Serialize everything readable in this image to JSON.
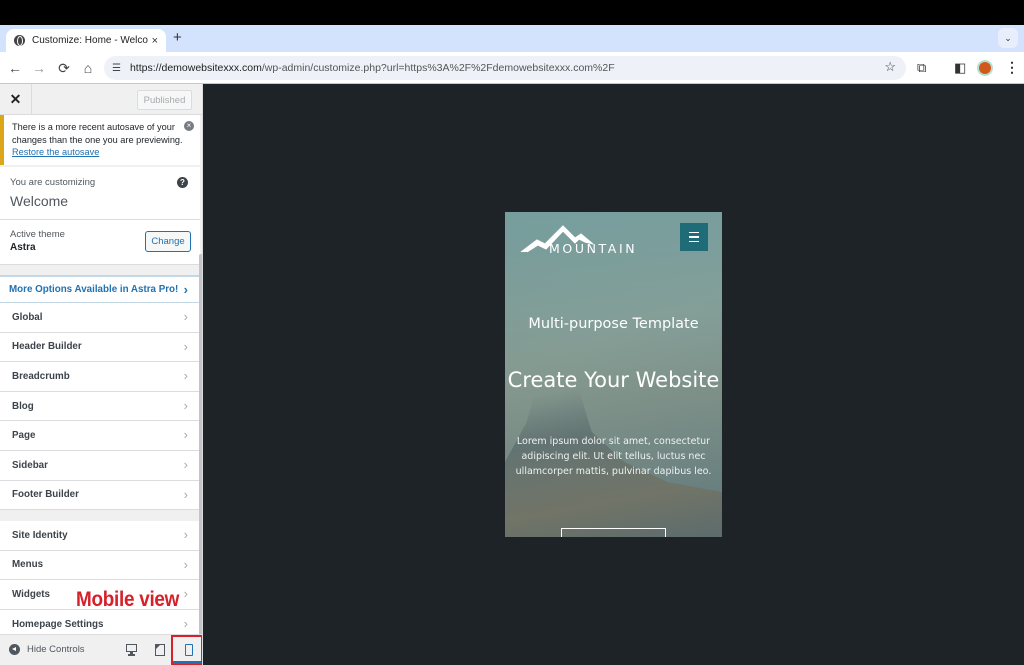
{
  "browser": {
    "tab_title": "Customize: Home - Welcome",
    "tab_close": "×",
    "new_tab": "+",
    "tab_list": "⌄",
    "url_host": "https://demowebsitexxx.com",
    "url_rest": "/wp-admin/customize.php?url=https%3A%2F%2Fdemowebsitexxx.com%2F",
    "nav": {
      "back": "←",
      "forward": "→",
      "reload": "⟳",
      "home": "⌂"
    },
    "bookmark_icon": "☆",
    "extensions_icon": "⧉",
    "sidepanel_icon": "◧",
    "menu_icon": "⋮"
  },
  "customizer": {
    "close_label": "✕",
    "publish_label": "Published",
    "notice": {
      "text": "There is a more recent autosave of your changes than the one you are previewing.",
      "link": "Restore the autosave",
      "dismiss": "×"
    },
    "customizing": {
      "label": "You are customizing",
      "title": "Welcome",
      "help": "?"
    },
    "theme": {
      "label": "Active theme",
      "name": "Astra",
      "change_label": "Change"
    },
    "pro_item": {
      "label": "More Options Available in Astra Pro!",
      "chev": "›"
    },
    "sections_group1": [
      {
        "label": "Global",
        "chev": "›"
      },
      {
        "label": "Header Builder",
        "chev": "›"
      },
      {
        "label": "Breadcrumb",
        "chev": "›"
      },
      {
        "label": "Blog",
        "chev": "›"
      },
      {
        "label": "Page",
        "chev": "›"
      },
      {
        "label": "Sidebar",
        "chev": "›"
      },
      {
        "label": "Footer Builder",
        "chev": "›"
      }
    ],
    "sections_group2": [
      {
        "label": "Site Identity",
        "chev": "›"
      },
      {
        "label": "Menus",
        "chev": "›"
      },
      {
        "label": "Widgets",
        "chev": "›"
      },
      {
        "label": "Homepage Settings",
        "chev": "›"
      }
    ],
    "footer": {
      "hide_controls": "Hide Controls",
      "active_device": "mobile"
    }
  },
  "annotation": {
    "text": "Mobile view",
    "color": "#d6202a"
  },
  "preview": {
    "logo_text": "MOUNTAIN",
    "hero_subtitle": "Multi-purpose Template",
    "hero_title": "Create Your Website",
    "hero_body": "Lorem ipsum dolor sit amet, consectetur adipiscing elit. Ut elit tellus, luctus nec ullamcorper mattis, pulvinar dapibus leo.",
    "accent_color": "#1f6b78"
  }
}
